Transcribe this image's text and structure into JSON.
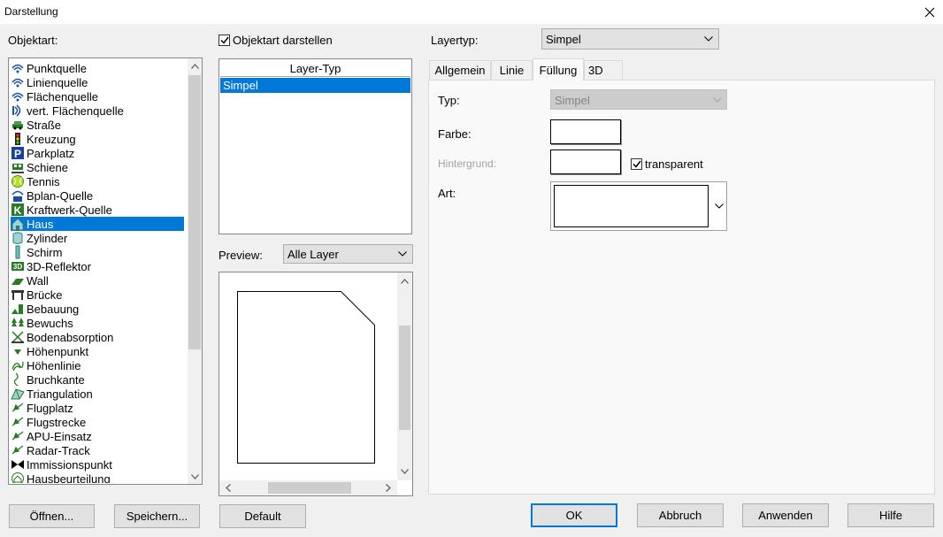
{
  "window": {
    "title": "Darstellung"
  },
  "objektart": {
    "label": "Objektart:",
    "items": [
      {
        "label": "Punktquelle",
        "icon": "wave-icon"
      },
      {
        "label": "Linienquelle",
        "icon": "wave-icon"
      },
      {
        "label": "Flächenquelle",
        "icon": "wave-icon"
      },
      {
        "label": "vert. Flächenquelle",
        "icon": "vertical-wave-icon"
      },
      {
        "label": "Straße",
        "icon": "car-icon"
      },
      {
        "label": "Kreuzung",
        "icon": "traffic-light-icon"
      },
      {
        "label": "Parkplatz",
        "icon": "parking-icon"
      },
      {
        "label": "Schiene",
        "icon": "train-icon"
      },
      {
        "label": "Tennis",
        "icon": "tennis-ball-icon"
      },
      {
        "label": "Bplan-Quelle",
        "icon": "bplan-icon"
      },
      {
        "label": "Kraftwerk-Quelle",
        "icon": "power-plant-k-icon"
      },
      {
        "label": "Haus",
        "icon": "house-icon"
      },
      {
        "label": "Zylinder",
        "icon": "cylinder-icon"
      },
      {
        "label": "Schirm",
        "icon": "screen-icon"
      },
      {
        "label": "3D-Reflektor",
        "icon": "3d-reflector-icon"
      },
      {
        "label": "Wall",
        "icon": "wall-icon"
      },
      {
        "label": "Brücke",
        "icon": "bridge-icon"
      },
      {
        "label": "Bebauung",
        "icon": "buildings-icon"
      },
      {
        "label": "Bewuchs",
        "icon": "trees-icon"
      },
      {
        "label": "Bodenabsorption",
        "icon": "ground-absorption-icon"
      },
      {
        "label": "Höhenpunkt",
        "icon": "height-point-icon"
      },
      {
        "label": "Höhenlinie",
        "icon": "contour-line-icon"
      },
      {
        "label": "Bruchkante",
        "icon": "break-line-icon"
      },
      {
        "label": "Triangulation",
        "icon": "triangulation-icon"
      },
      {
        "label": "Flugplatz",
        "icon": "airplane-icon"
      },
      {
        "label": "Flugstrecke",
        "icon": "airplane-icon"
      },
      {
        "label": "APU-Einsatz",
        "icon": "airplane-icon"
      },
      {
        "label": "Radar-Track",
        "icon": "airplane-icon"
      },
      {
        "label": "Immissionspunkt",
        "icon": "bowtie-icon"
      },
      {
        "label": "Hausbeurteilung",
        "icon": "house-assessment-icon"
      }
    ],
    "selected": "Haus"
  },
  "objektart_darstellen": {
    "label": "Objektart darstellen",
    "checked": true
  },
  "layer_typ": {
    "header": "Layer-Typ",
    "items": [
      "Simpel"
    ],
    "selected": "Simpel"
  },
  "preview": {
    "label": "Preview:",
    "value": "Alle Layer"
  },
  "layertyp": {
    "label": "Layertyp:",
    "value": "Simpel"
  },
  "tabs": [
    {
      "label": "Allgemein"
    },
    {
      "label": "Linie"
    },
    {
      "label": "Füllung",
      "active": true
    },
    {
      "label": "3D"
    }
  ],
  "fill": {
    "typ_label": "Typ:",
    "typ_value": "Simpel",
    "farbe_label": "Farbe:",
    "hintergrund_label": "Hintergrund:",
    "transparent_label": "transparent",
    "transparent_checked": true,
    "art_label": "Art:"
  },
  "buttons": {
    "open": "Öffnen...",
    "save": "Speichern...",
    "default": "Default",
    "ok": "OK",
    "cancel": "Abbruch",
    "apply": "Anwenden",
    "help": "Hilfe"
  },
  "colors": {
    "accent": "#0078d7",
    "selection": "#0078d7"
  }
}
